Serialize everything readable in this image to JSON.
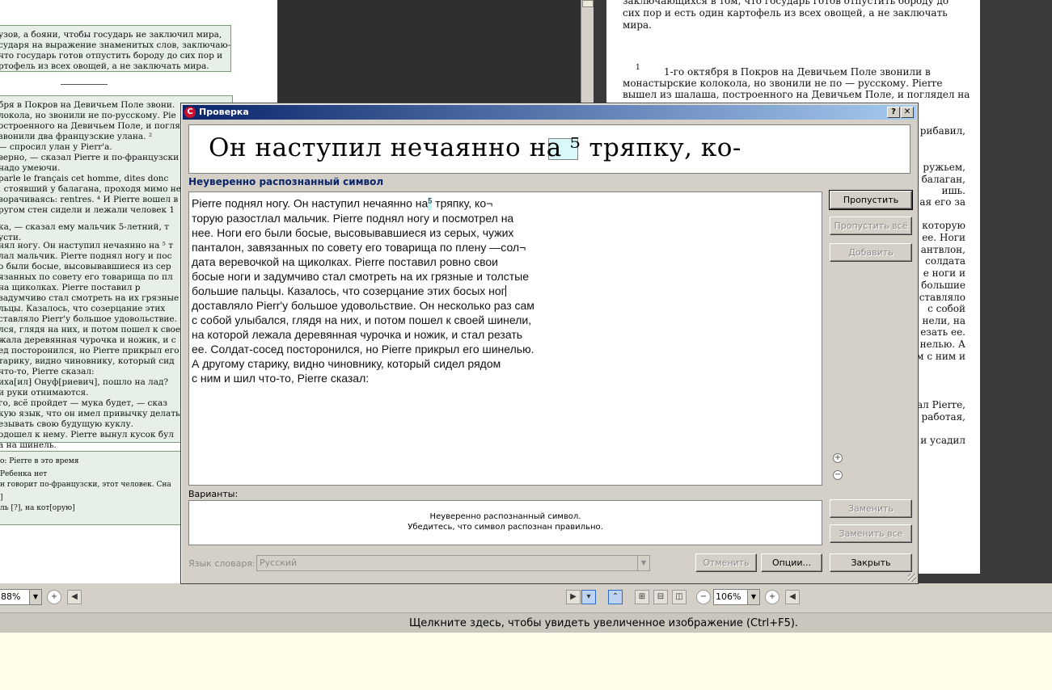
{
  "background": {
    "left_page_lines": [
      "узов, а бояни, чтобы государь не заключил мира,",
      "сударя на выражение знаменитых слов, заключаю-",
      "что государь готов отпустить бороду до сих пор и",
      "ртофель из всех овощей, а не заключать мира.",
      "бря в Покров на Девичьем Поле звони.",
      "локола, но звонили не по-русскому. Pie",
      "остроенного на Девичьем Поле, и поглядо",
      "звонили два французские улана. ²",
      "— спросил улан у Pierr'а.",
      "верно, — сказал Pierre и по-французски",
      "надо умеючи.",
      "parle le français cet homme, dites donc",
      ", стоявший у балагана, проходя мимо него",
      "ворачиваясь: rentres. ⁴ И Pierre вошел в",
      "ругом стен сидели и лежали человек 1",
      "ка, — сказал ему мальчик 5-летний, т",
      "усти.",
      "нял ногу. Он наступил нечаянно на ⁵ т",
      "лал мальчик. Pierre поднял ногу и пос",
      "о были босые, высовывавшиеся из сер",
      "язанных по совету его товарища по пл",
      "на щиколках. Pierre поставил р",
      "задумчиво стал смотреть на их грязные",
      "льцы. Казалось, что созерцание этих",
      "ставляло Pierr'у большое удовольствие. Он несколь",
      "лся, глядя на них, и потом пошел к свое",
      "жала деревянная чурочка и ножик, и с",
      "ед посторонился, но Pierre прикрыл его",
      "тарику, видно чиновнику, который сид",
      "что-то, Pierre сказал:",
      "иха[ил] Онуф[риевич], пошло на лад?",
      "и руки отнимаются.",
      "го, всё пройдет — мука будет, — сказ",
      "кую язык, что он имел привычку делать",
      "езывать свою будущую куклу.",
      "одошел к нему. Pierre вынул кусок бул",
      "а на шинель.",
      "о: Pierre в это время",
      "Ребенка нет",
      "н говорит по-французски, этот человек. Сна",
      "]",
      "ль [?], на кот[орую]"
    ],
    "right_text_top": [
      "заключающихся в том, что государь готов отпустить бороду до",
      "сих пор и есть один картофель из всех овощей, а не заключать",
      "мира."
    ],
    "right_text_footnote_marker": "1",
    "right_text_para": [
      "1-го октября в Покров на Девичьем Поле звонили в",
      "монастырские колокола, но звонили не по — русскому. Pierre",
      "вышел из шалаша, построенного на Девичьем Поле, и поглядел на"
    ],
    "right_text_fragments": [
      "рибавил,",
      "ружьем,",
      "балаган,",
      "ишь.",
      "ая его за",
      "которую",
      "ее. Ноги",
      "антвлон,",
      "солдата",
      "е ноги и",
      "большие",
      "ставляло",
      "с собой",
      "нели, на",
      "езать ее.",
      "нелью. А",
      "м с ним и",
      "ал Pierre,",
      "работая,",
      "и усадил"
    ]
  },
  "dialog": {
    "title": "Проверка",
    "help_button": "?",
    "close_button": "✕",
    "preview_text": "Он наступил нечаянно на ⁵ тряпку, ко-",
    "section_label": "Неуверенно распознанный символ",
    "editor_lines": [
      "Pierre поднял ногу. Он наступил нечаянно на",
      "торую разостлал мальчик. Pierre поднял ногу и посмотрел на",
      "нее. Ноги его были босые, высовывавшиеся из серых, чужих",
      "панталон, завязанных по совету его товарища по плену —сол¬",
      "дата веревочкой на щиколках. Pierre поставил ровно свои",
      "босые ноги и задумчиво стал смотреть на их грязные и толстые",
      "большие пальцы. Казалось, что созерцание этих босых ног",
      "доставляло Pierr'у большое удовольствие. Он несколько раз сам",
      "с собой улыбался, глядя на них, и потом пошел к своей шинели,",
      "на которой лежала деревянная чурочка и ножик, и стал резать",
      "ее. Солдат-сосед посторонился, но Pierre прикрыл его шинелью.",
      "А другому старику, видно чиновнику, который сидел рядом",
      "с ним и шил что-то, Pierre сказал:"
    ],
    "editor_first_line_tail": " тряпку, ко¬",
    "editor_superscript": "5",
    "buttons": {
      "skip": "Пропустить",
      "skip_all": "Пропустить всё",
      "add": "Добавить",
      "replace": "Заменить",
      "replace_all": "Заменить все",
      "undo": "Отменить",
      "options": "Опции...",
      "close": "Закрыть"
    },
    "zoom_in": "+",
    "zoom_out": "−",
    "variants_label": "Варианты:",
    "variants_message_line1": "Неуверенно распознанный символ.",
    "variants_message_line2": "Убедитесь, что символ распознан правильно.",
    "dict_label": "Язык словаря:",
    "dict_value": "Русский"
  },
  "toolbar": {
    "left_zoom_value": "88%",
    "right_zoom_value": "106%"
  },
  "status": {
    "text": "Щелкните здесь, чтобы увидеть увеличенное изображение (Ctrl+F5)."
  },
  "colors": {
    "titlebar_start": "#0a246a",
    "titlebar_end": "#a6caf0",
    "highlight": "#bff4f8",
    "status_background": "#fffde8"
  }
}
